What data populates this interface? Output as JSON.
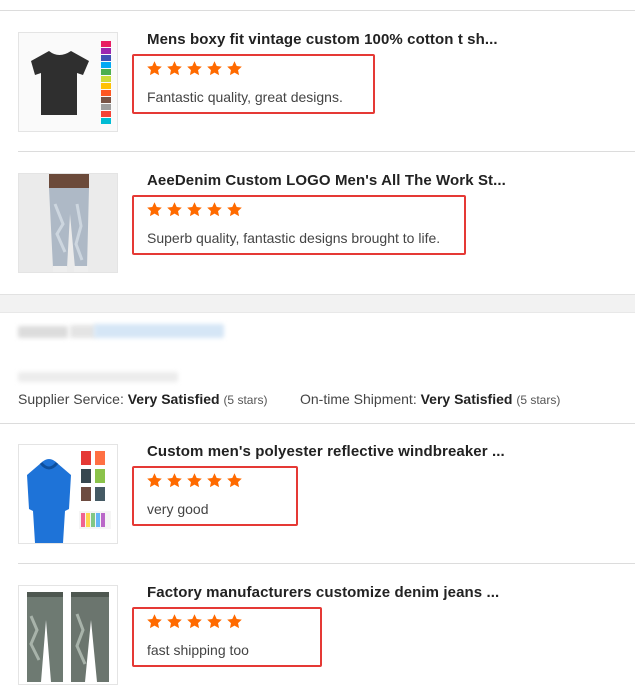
{
  "colors": {
    "star": "#ff6a00",
    "highlight_box": "#e53935"
  },
  "reviews_top": [
    {
      "title": "Mens boxy fit vintage custom 100% cotton t sh...",
      "rating": 5,
      "comment": "Fantastic quality, great designs.",
      "thumb_icon": "tshirt-icon"
    },
    {
      "title": "AeeDenim Custom LOGO Men's All The Work St...",
      "rating": 5,
      "comment": "Superb quality, fantastic designs brought to life.",
      "thumb_icon": "jeans-icon"
    }
  ],
  "supplier": {
    "service_label": "Supplier Service:",
    "service_value": "Very Satisfied",
    "service_stars": "(5 stars)",
    "shipment_label": "On-time Shipment:",
    "shipment_value": "Very Satisfied",
    "shipment_stars": "(5 stars)"
  },
  "reviews_bottom": [
    {
      "title": "Custom men's polyester reflective windbreaker ...",
      "rating": 5,
      "comment": "very good",
      "thumb_icon": "windbreaker-icon"
    },
    {
      "title": "Factory manufacturers customize denim jeans ...",
      "rating": 5,
      "comment": "fast shipping too",
      "thumb_icon": "denim-jeans-icon"
    }
  ]
}
